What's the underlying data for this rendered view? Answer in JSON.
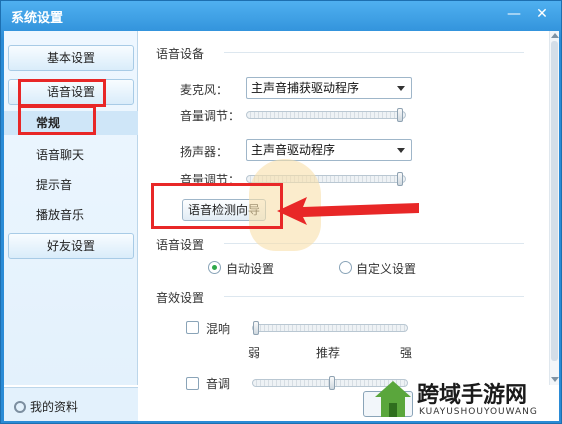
{
  "window": {
    "title": "系统设置",
    "minimize_glyph": "—",
    "close_glyph": "✕"
  },
  "sidebar": {
    "basic": "基本设置",
    "voice": "语音设置",
    "subitems": [
      "常规",
      "语音聊天",
      "提示音",
      "播放音乐"
    ],
    "friends": "好友设置",
    "my_info": "我的资料"
  },
  "voice_device": {
    "section": "语音设备",
    "mic_label": "麦克风：",
    "mic_value": "主声音捕获驱动程序",
    "mic_volume_label": "音量调节：",
    "speaker_label": "扬声器：",
    "speaker_value": "主声音驱动程序",
    "speaker_volume_label": "音量调节：",
    "wizard_button": "语音检测向导"
  },
  "voice_settings": {
    "section": "语音设置",
    "auto": "自动设置",
    "custom": "自定义设置"
  },
  "effects": {
    "section": "音效设置",
    "reverb": "混响",
    "weak": "弱",
    "recommended": "推荐",
    "strong": "强",
    "tone": "音调"
  },
  "watermark": {
    "title": "跨域手游网",
    "subtitle": "KUAYUSHOUYOUWANG"
  },
  "colors": {
    "accent": "#2a8bd6",
    "annotation": "#e82727",
    "radio_on": "#2fa84a"
  }
}
